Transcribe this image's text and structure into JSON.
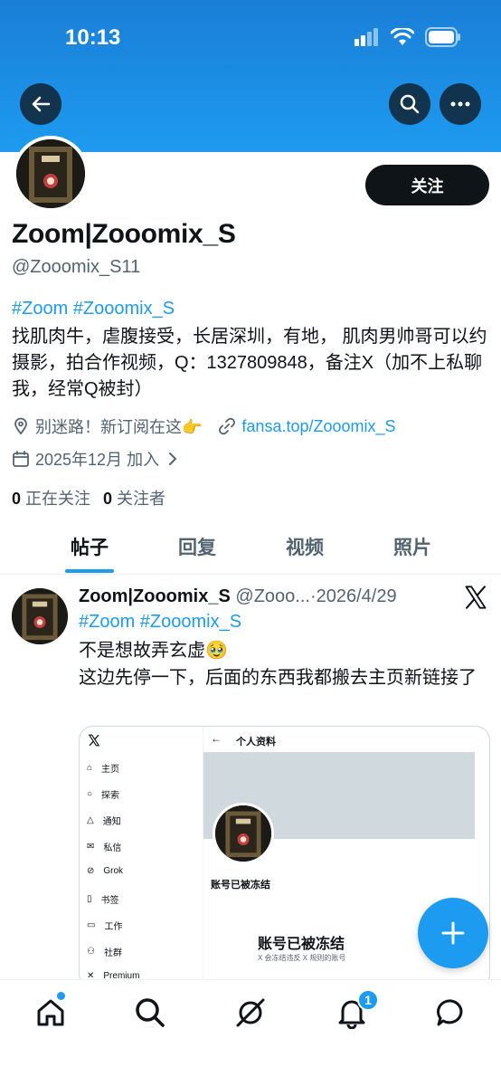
{
  "status_bar": {
    "time": "10:13"
  },
  "profile": {
    "follow_label": "关注",
    "name": "Zoom|Zooomix_S",
    "handle": "@Zooomix_S11",
    "hashtags": "#Zoom #Zooomix_S",
    "bio": "找肌肉牛，虐腹接受，长居深圳，有地， 肌肉男帅哥可以约摄影，拍合作视频，Q：1327809848，备注X（加不上私聊我，经常Q被封）",
    "location": "别迷路！新订阅在这👉",
    "link": "fansa.top/Zooomix_S",
    "joined": "2025年12月 加入",
    "following_count": "0",
    "following_label": "正在关注",
    "followers_count": "0",
    "followers_label": "关注者"
  },
  "tabs": [
    {
      "label": "帖子",
      "active": true
    },
    {
      "label": "回复",
      "active": false
    },
    {
      "label": "视频",
      "active": false
    },
    {
      "label": "照片",
      "active": false
    }
  ],
  "post": {
    "author_name": "Zoom|Zooomix_S",
    "author_handle": "@Zooo...",
    "date": "·2026/4/29",
    "hashtags": "#Zoom #Zooomix_S",
    "text_line1": "不是想故弄玄虚🥹",
    "text_line2": "这边先停一下，后面的东西我都搬去主页新链接了",
    "embed": {
      "page_title": "个人资料",
      "sidebar": [
        "主页",
        "探索",
        "通知",
        "私信",
        "Grok",
        "书签",
        "工作",
        "社群",
        "Premium"
      ],
      "frozen_name": "账号已被冻结",
      "frozen_heading": "账号已被冻结",
      "frozen_desc": "X 会冻结违反 X 规则的账号"
    }
  },
  "notifications_badge": "1",
  "colors": {
    "accent": "#1d9bf0",
    "text": "#0f1419",
    "muted": "#536471"
  }
}
